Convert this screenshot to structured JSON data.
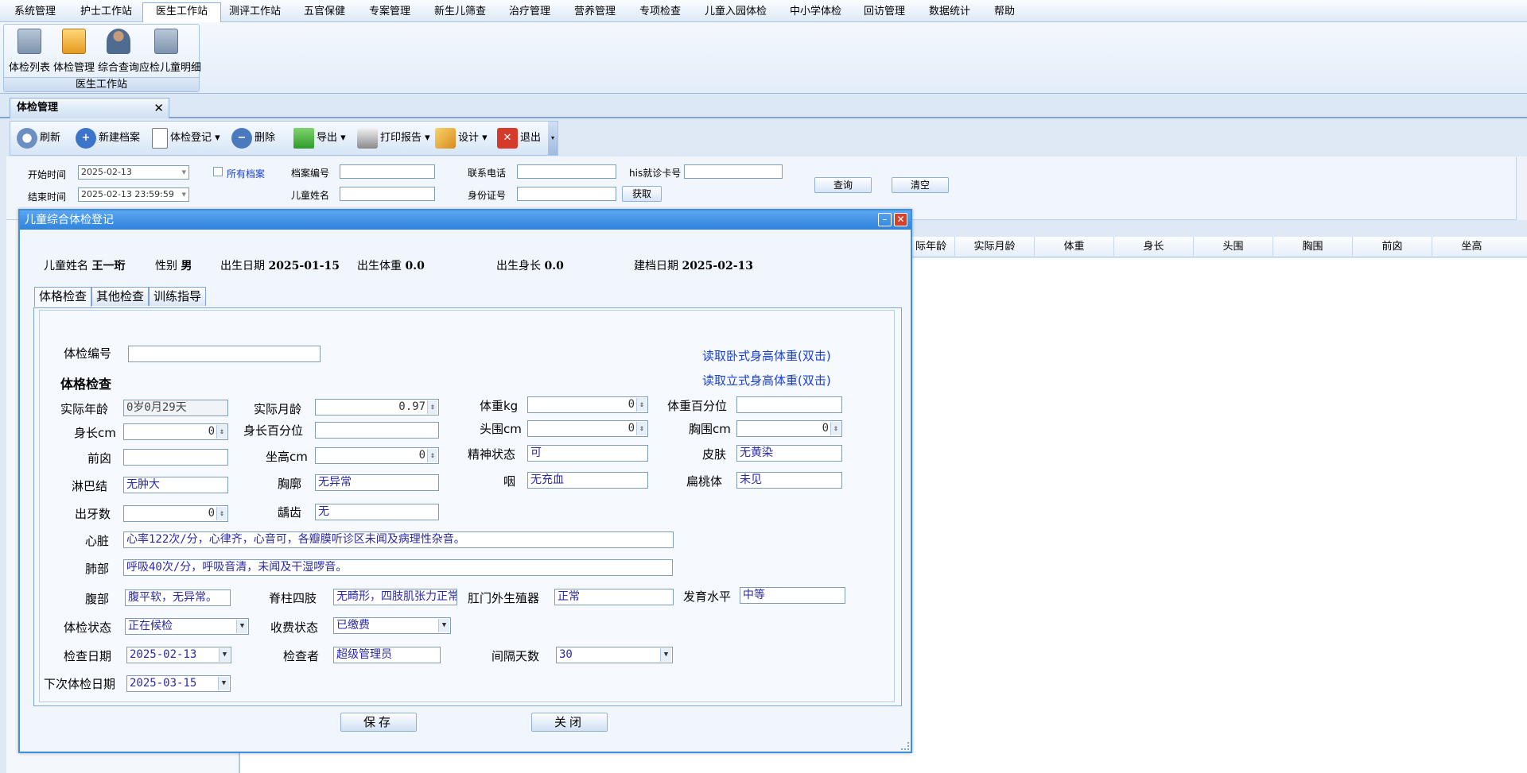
{
  "menu": [
    "系统管理",
    "护士工作站",
    "医生工作站",
    "测评工作站",
    "五官保健",
    "专案管理",
    "新生儿筛查",
    "治疗管理",
    "营养管理",
    "专项检查",
    "儿童入园体检",
    "中小学体检",
    "回访管理",
    "数据统计",
    "帮助"
  ],
  "ribbon": {
    "buttons": [
      "体检列表",
      "体检管理",
      "综合查询",
      "应检儿童明细"
    ],
    "group_title": "医生工作站"
  },
  "doc_tab": {
    "label": "体检管理",
    "close": "✕"
  },
  "toolbar": {
    "refresh": "刷新",
    "new_record": "新建档案",
    "register": "体检登记 ▾",
    "delete": "删除",
    "export": "导出 ▾",
    "print": "打印报告 ▾",
    "design": "设计 ▾",
    "exit": "退出"
  },
  "filter": {
    "start_label": "开始时间",
    "start_value": "2025-02-13",
    "end_label": "结束时间",
    "end_value": "2025-02-13 23:59:59",
    "all_records": "所有档案",
    "record_no_label": "档案编号",
    "child_name_label": "儿童姓名",
    "phone_label": "联系电话",
    "id_label": "身份证号",
    "fetch": "获取",
    "his_label": "his就诊卡号",
    "query": "查询",
    "clear": "清空"
  },
  "grid": {
    "columns": [
      "际年龄",
      "实际月龄",
      "体重",
      "身长",
      "头围",
      "胸围",
      "前囟",
      "坐高"
    ]
  },
  "dialog": {
    "title": "儿童综合体检登记",
    "info": {
      "name_label": "儿童姓名",
      "name": "王一珩",
      "sex_label": "性别",
      "sex": "男",
      "birth_label": "出生日期",
      "birth": "2025-01-15",
      "bw_label": "出生体重",
      "bw": "0.0",
      "bl_label": "出生身长",
      "bl": "0.0",
      "created_label": "建档日期",
      "created": "2025-02-13"
    },
    "tabs": [
      "体格检查",
      "其他检查",
      "训练指导"
    ],
    "exam_no_label": "体检编号",
    "exam_no": "",
    "section_title": "体格检查",
    "link_lying": "读取卧式身高体重(双击)",
    "link_standing": "读取立式身高体重(双击)",
    "fields": {
      "age_label": "实际年龄",
      "age": "0岁0月29天",
      "month_label": "实际月龄",
      "month": "0.97",
      "weight_label": "体重kg",
      "weight": "0",
      "weight_pct_label": "体重百分位",
      "weight_pct": "",
      "height_label": "身长cm",
      "height": "0",
      "height_pct_label": "身长百分位",
      "height_pct": "",
      "head_label": "头围cm",
      "head": "0",
      "chest_label": "胸围cm",
      "chest": "0",
      "fontanelle_label": "前囟",
      "fontanelle": "",
      "sit_label": "坐高cm",
      "sit": "0",
      "mental_label": "精神状态",
      "mental": "可",
      "skin_label": "皮肤",
      "skin": "无黄染",
      "lymph_label": "淋巴结",
      "lymph": "无肿大",
      "thorax_label": "胸廓",
      "thorax": "无异常",
      "throat_label": "咽",
      "throat": "无充血",
      "tonsil_label": "扁桃体",
      "tonsil": "未见",
      "teeth_label": "出牙数",
      "teeth": "0",
      "caries_label": "龋齿",
      "caries": "无",
      "heart_label": "心脏",
      "heart": "心率122次/分，心律齐，心音可，各瓣膜听诊区未闻及病理性杂音。",
      "lung_label": "肺部",
      "lung": "呼吸40次/分，呼吸音清，未闻及干湿啰音。",
      "abdomen_label": "腹部",
      "abdomen": "腹平软，无异常。",
      "spine_label": "脊柱四肢",
      "spine": "无畸形，四肢肌张力正常",
      "genital_label": "肛门外生殖器",
      "genital": "正常",
      "dev_label": "发育水平",
      "dev": "中等",
      "status_label": "体检状态",
      "status": "正在候检",
      "fee_label": "收费状态",
      "fee": "已缴费",
      "date_label": "检查日期",
      "date": "2025-02-13",
      "examiner_label": "检查者",
      "examiner": "超级管理员",
      "interval_label": "间隔天数",
      "interval": "30",
      "next_label": "下次体检日期",
      "next": "2025-03-15"
    },
    "save": "保存",
    "close": "关闭"
  }
}
